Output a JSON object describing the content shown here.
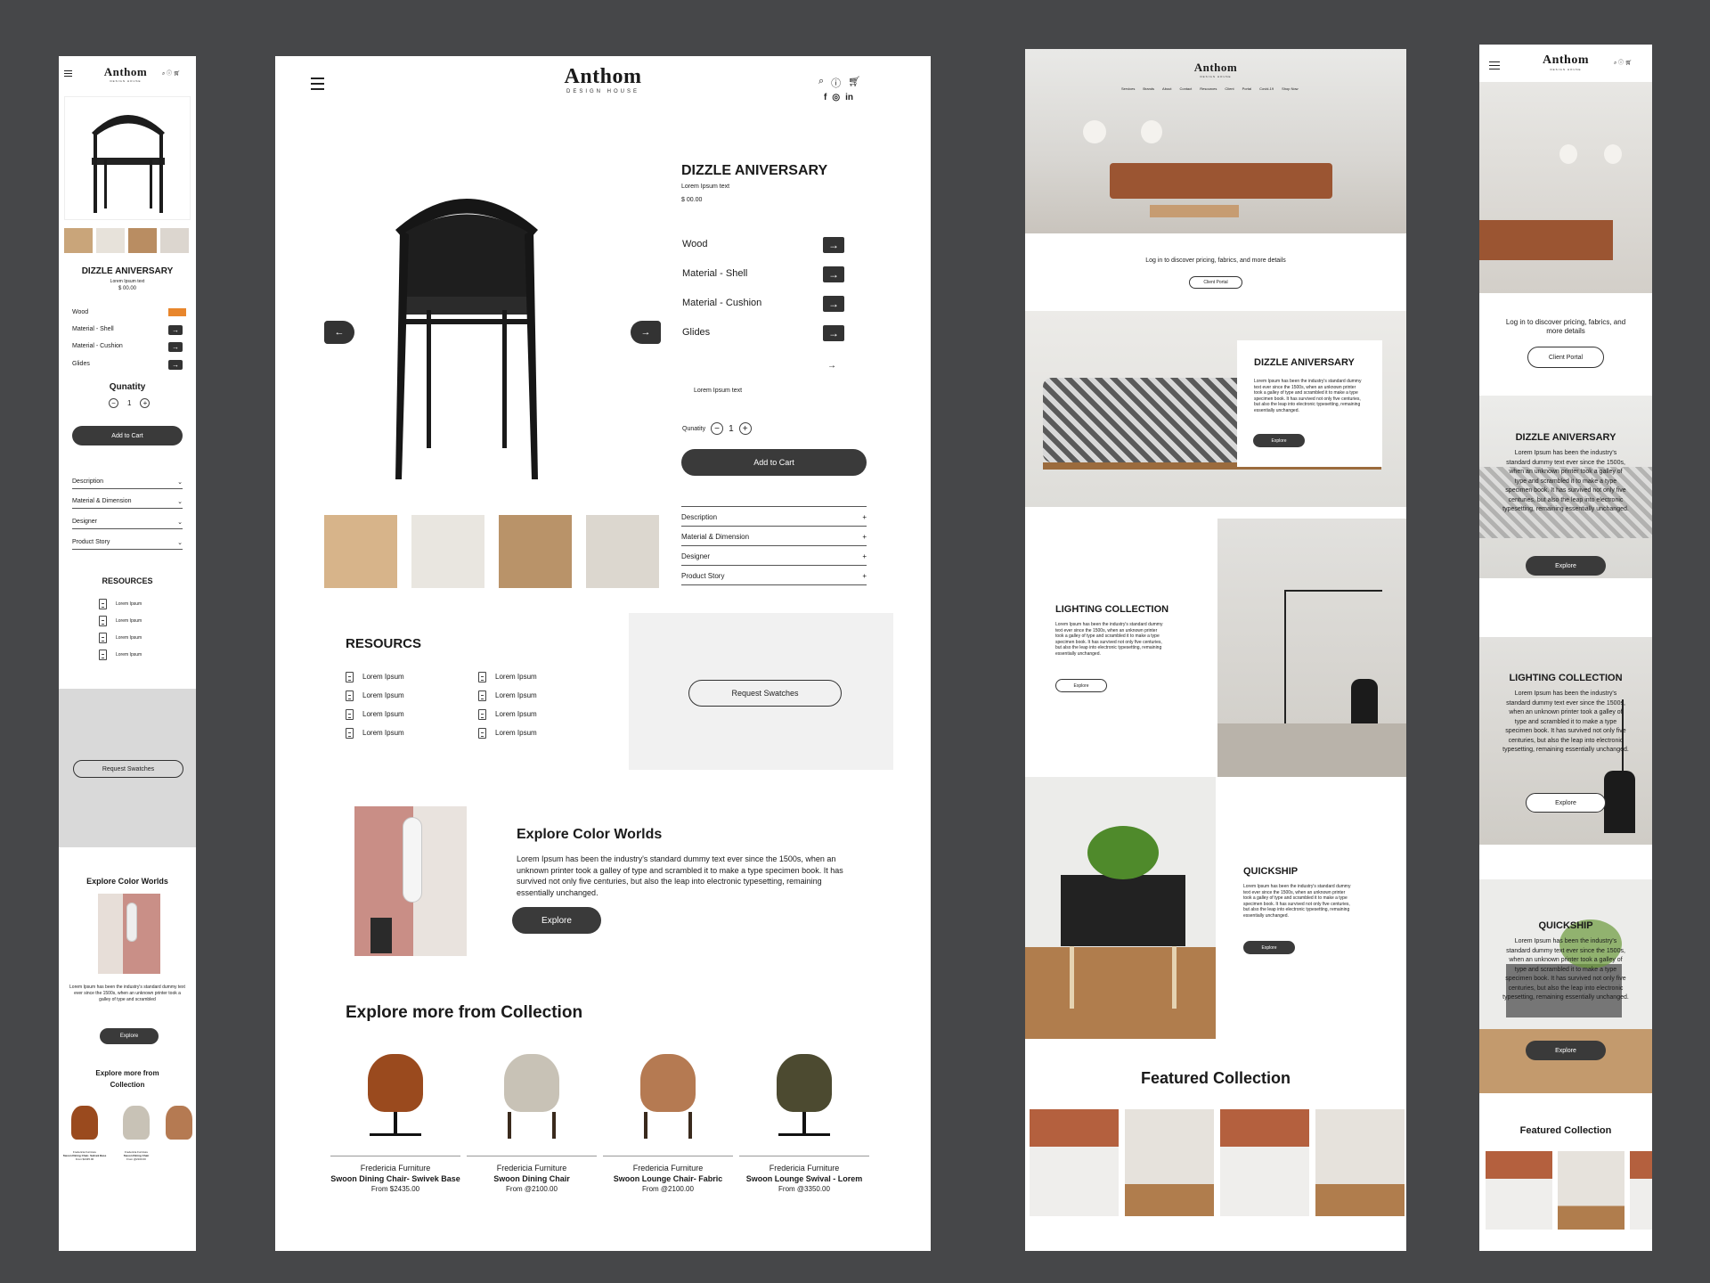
{
  "brand": {
    "name": "Anthom",
    "tagline": "DESIGN HOUSE"
  },
  "product": {
    "title": "DIZZLE ANIVERSARY",
    "subtitle": "Lorem Ipsum text",
    "price": "$ 00.00",
    "options": [
      "Wood",
      "Material - Shell",
      "Material - Cushion",
      "Glides"
    ],
    "note": "Lorem Ipsum text",
    "qty_label_mobile": "Qunatity",
    "qty_label": "Qunatity",
    "qty": "1",
    "add_to_cart": "Add to Cart"
  },
  "accordion": [
    "Description",
    "Material & Dimension",
    "Designer",
    "Product Story"
  ],
  "resources": {
    "title_desktop": "RESOURCS",
    "title_mobile": "RESOURCES",
    "item": "Lorem Ipsum",
    "request": "Request Swatches"
  },
  "explore": {
    "title": "Explore Color Worlds",
    "body": "Lorem Ipsum has been the industry's standard dummy text ever since the 1500s, when an unknown printer took a galley of type and scrambled it to make a type specimen book. It has survived not only five centuries, but also the leap into electronic typesetting, remaining essentially unchanged.",
    "body_mobile": "Lorem Ipsum has been the industry's standard dummy text ever since the 1500s, when an unknown printer took a galley of type and scrambled",
    "button": "Explore"
  },
  "collection": {
    "title": "Explore more from Collection",
    "title_mobile_1": "Explore more from",
    "title_mobile_2": "Collection",
    "items": [
      {
        "brand": "Fredericia Furniture",
        "name": "Swoon Dining Chair- Swivek Base",
        "price": "From $2435.00",
        "color": "#9a4a1e"
      },
      {
        "brand": "Fredericia Furniture",
        "name": "Swoon Dining Chair",
        "price": "From @2100.00",
        "color": "#c8c2b6"
      },
      {
        "brand": "Fredericia Furniture",
        "name": "Swoon Lounge Chair- Fabric",
        "price": "From @2100.00",
        "color": "#b57a52"
      },
      {
        "brand": "Fredericia Furniture",
        "name": "Swoon Lounge Swival - Lorem",
        "price": "From @3350.00",
        "color": "#4c4a30"
      }
    ]
  },
  "home": {
    "nav": [
      "Services",
      "Brands",
      "About",
      "Contact",
      "Resources",
      "Client",
      "Portal",
      "Covid-19",
      "Shop Now"
    ],
    "login_text": "Log in to discover pricing, fabrics, and more details",
    "client_portal": "Client Portal",
    "dizzle_title": "DIZZLE ANIVERSARY",
    "lorem": "Lorem Ipsum has been the industry's standard dummy text ever since the 1500s, when an unknown printer took a galley of type and scrambled it to make a type specimen book. It has survived not only five centuries, but also the leap into electronic typesetting, remaining essentially unchanged.",
    "lighting_title": "LIGHTING COLLECTION",
    "quickship_title": "QUICKSHIP",
    "explore": "Explore",
    "featured": "Featured Collection"
  },
  "colors": {
    "bg": "#464749",
    "dark": "#3a3a3a",
    "accent_orange": "#e8862c",
    "grey_panel": "#f1f1f1",
    "mobile_grey": "#d9d9d9"
  }
}
